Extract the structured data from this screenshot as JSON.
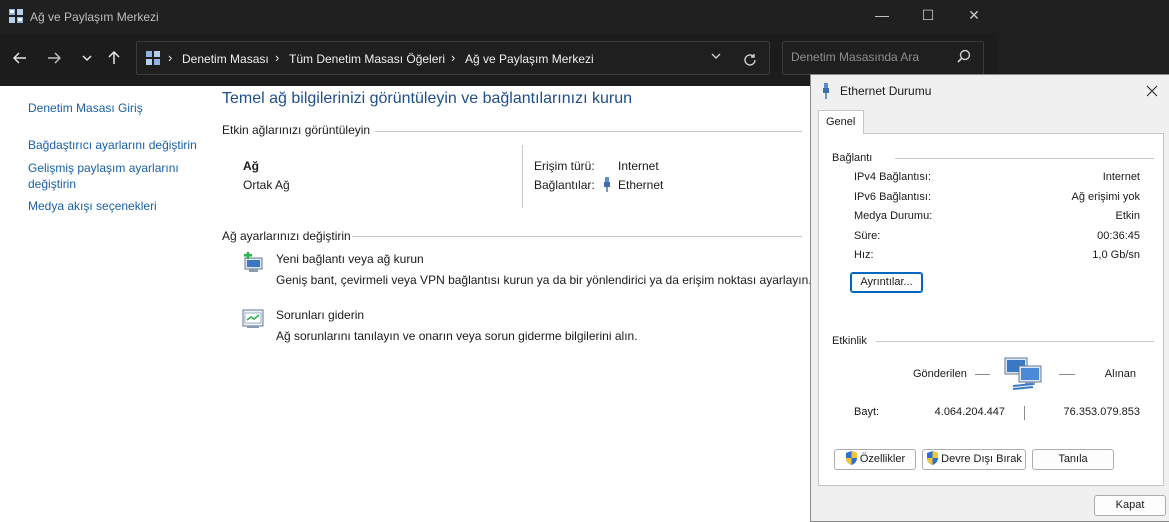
{
  "window": {
    "title": "Ağ ve Paylaşım Merkezi",
    "controls": {
      "minimize": "—",
      "maximize": "☐",
      "close": "✕"
    }
  },
  "addressbar": {
    "breadcrumbs": [
      "Denetim Masası",
      "Tüm Denetim Masası Öğeleri",
      "Ağ ve Paylaşım Merkezi"
    ],
    "separator": "›",
    "search_placeholder": "Denetim Masasında Ara"
  },
  "sidebar": {
    "items": [
      {
        "label": "Denetim Masası Giriş"
      },
      {
        "label": "Bağdaştırıcı ayarlarını değiştirin"
      },
      {
        "label": "Gelişmiş paylaşım ayarlarını değiştirin"
      },
      {
        "label": "Medya akışı seçenekleri"
      }
    ]
  },
  "main": {
    "title": "Temel ağ bilgilerinizi görüntüleyin ve bağlantılarınızı kurun",
    "active_networks": {
      "heading": "Etkin ağlarınızı görüntüleyin",
      "network_name": "Ağ",
      "network_type": "Ortak Ağ",
      "access_type_label": "Erişim türü:",
      "access_type_value": "Internet",
      "connections_label": "Bağlantılar:",
      "connections_value": "Ethernet"
    },
    "change_settings": {
      "heading": "Ağ ayarlarınızı değiştirin",
      "items": [
        {
          "title": "Yeni bağlantı veya ağ kurun",
          "description": "Geniş bant, çevirmeli veya VPN bağlantısı kurun ya da bir yönlendirici ya da erişim noktası ayarlayın."
        },
        {
          "title": "Sorunları giderin",
          "description": "Ağ sorunlarını tanılayın ve onarın veya sorun giderme bilgilerini alın."
        }
      ]
    }
  },
  "dialog": {
    "title": "Ethernet Durumu",
    "tab": "Genel",
    "connection_group": "Bağlantı",
    "rows": [
      {
        "label": "IPv4 Bağlantısı:",
        "value": "Internet"
      },
      {
        "label": "IPv6 Bağlantısı:",
        "value": "Ağ erişimi yok"
      },
      {
        "label": "Medya Durumu:",
        "value": "Etkin"
      },
      {
        "label": "Süre:",
        "value": "00:36:45"
      },
      {
        "label": "Hız:",
        "value": "1,0 Gb/sn"
      }
    ],
    "details_button": "Ayrıntılar...",
    "activity_group": "Etkinlik",
    "sent_label": "Gönderilen",
    "received_label": "Alınan",
    "bytes_label": "Bayt:",
    "bytes_sent": "4.064.204.447",
    "bytes_received": "76.353.079.853",
    "buttons": {
      "properties": "Özellikler",
      "disable": "Devre Dışı Bırak",
      "diagnose": "Tanıla",
      "close": "Kapat"
    }
  },
  "colors": {
    "link": "#1a5fa8",
    "title_blue": "#1e4e8c",
    "dark_chrome": "#202020"
  }
}
